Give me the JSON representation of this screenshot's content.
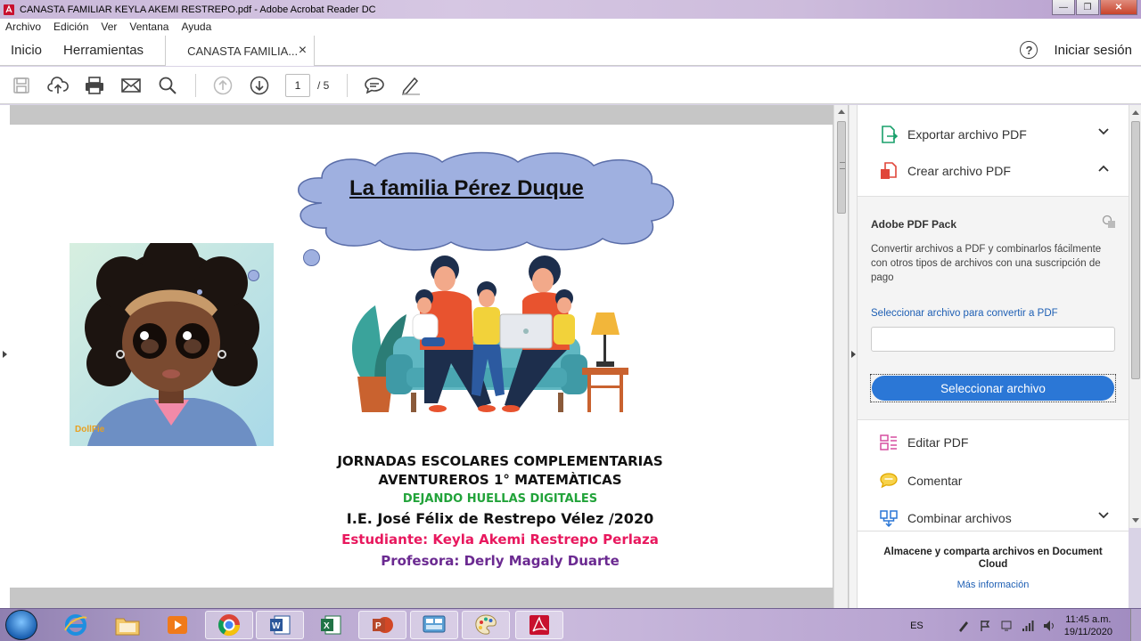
{
  "window": {
    "title": "CANASTA FAMILIAR KEYLA AKEMI RESTREPO.pdf - Adobe Acrobat Reader DC"
  },
  "menu": [
    "Archivo",
    "Edición",
    "Ver",
    "Ventana",
    "Ayuda"
  ],
  "tabs": {
    "home": "Inicio",
    "tools": "Herramientas",
    "document": "CANASTA FAMILIA...",
    "close_glyph": "×",
    "help_glyph": "?",
    "signin": "Iniciar sesión"
  },
  "toolbar": {
    "icons": [
      "save-icon",
      "upload-cloud-icon",
      "print-icon",
      "email-icon",
      "search-icon",
      "prev-page-icon",
      "next-page-icon",
      "comment-icon",
      "draw-icon"
    ],
    "current_page": "1",
    "page_total": "/ 5"
  },
  "document": {
    "cloud_title": "La familia Pérez Duque",
    "avatar_watermark": "DollFie",
    "line1": "JORNADAS ESCOLARES COMPLEMENTARIAS",
    "line2": "AVENTUREROS 1°  MATEMÀTICAS",
    "line3": "DEJANDO HUELLAS DIGITALES",
    "line4": "I.E. José Félix de Restrepo Vélez /2020",
    "line5": "Estudiante: Keyla Akemi Restrepo Perlaza",
    "line6": "Profesora: Derly Magaly Duarte",
    "colors": {
      "green": "#22a33a",
      "pink": "#e8185e",
      "purple": "#6b2a91",
      "cloud": "#9fb0e0"
    }
  },
  "rightpane": {
    "export": "Exportar archivo PDF",
    "create": "Crear archivo PDF",
    "pack": {
      "title": "Adobe PDF Pack",
      "description": "Convertir archivos a PDF y combinarlos fácilmente con otros tipos de archivos con una suscripción de pago",
      "link": "Seleccionar archivo para convertir a PDF",
      "button": "Seleccionar archivo"
    },
    "edit": "Editar PDF",
    "comment": "Comentar",
    "combine": "Combinar archivos",
    "cloud_note": "Almacene y comparta archivos en Document Cloud",
    "more_info": "Más información"
  },
  "taskbar": {
    "apps": [
      "internet-explorer",
      "file-explorer",
      "media-player",
      "chrome",
      "word",
      "excel",
      "powerpoint",
      "control-panel",
      "paint",
      "acrobat-reader"
    ],
    "language": "ES",
    "time": "11:45 a.m.",
    "date": "19/11/2020"
  }
}
